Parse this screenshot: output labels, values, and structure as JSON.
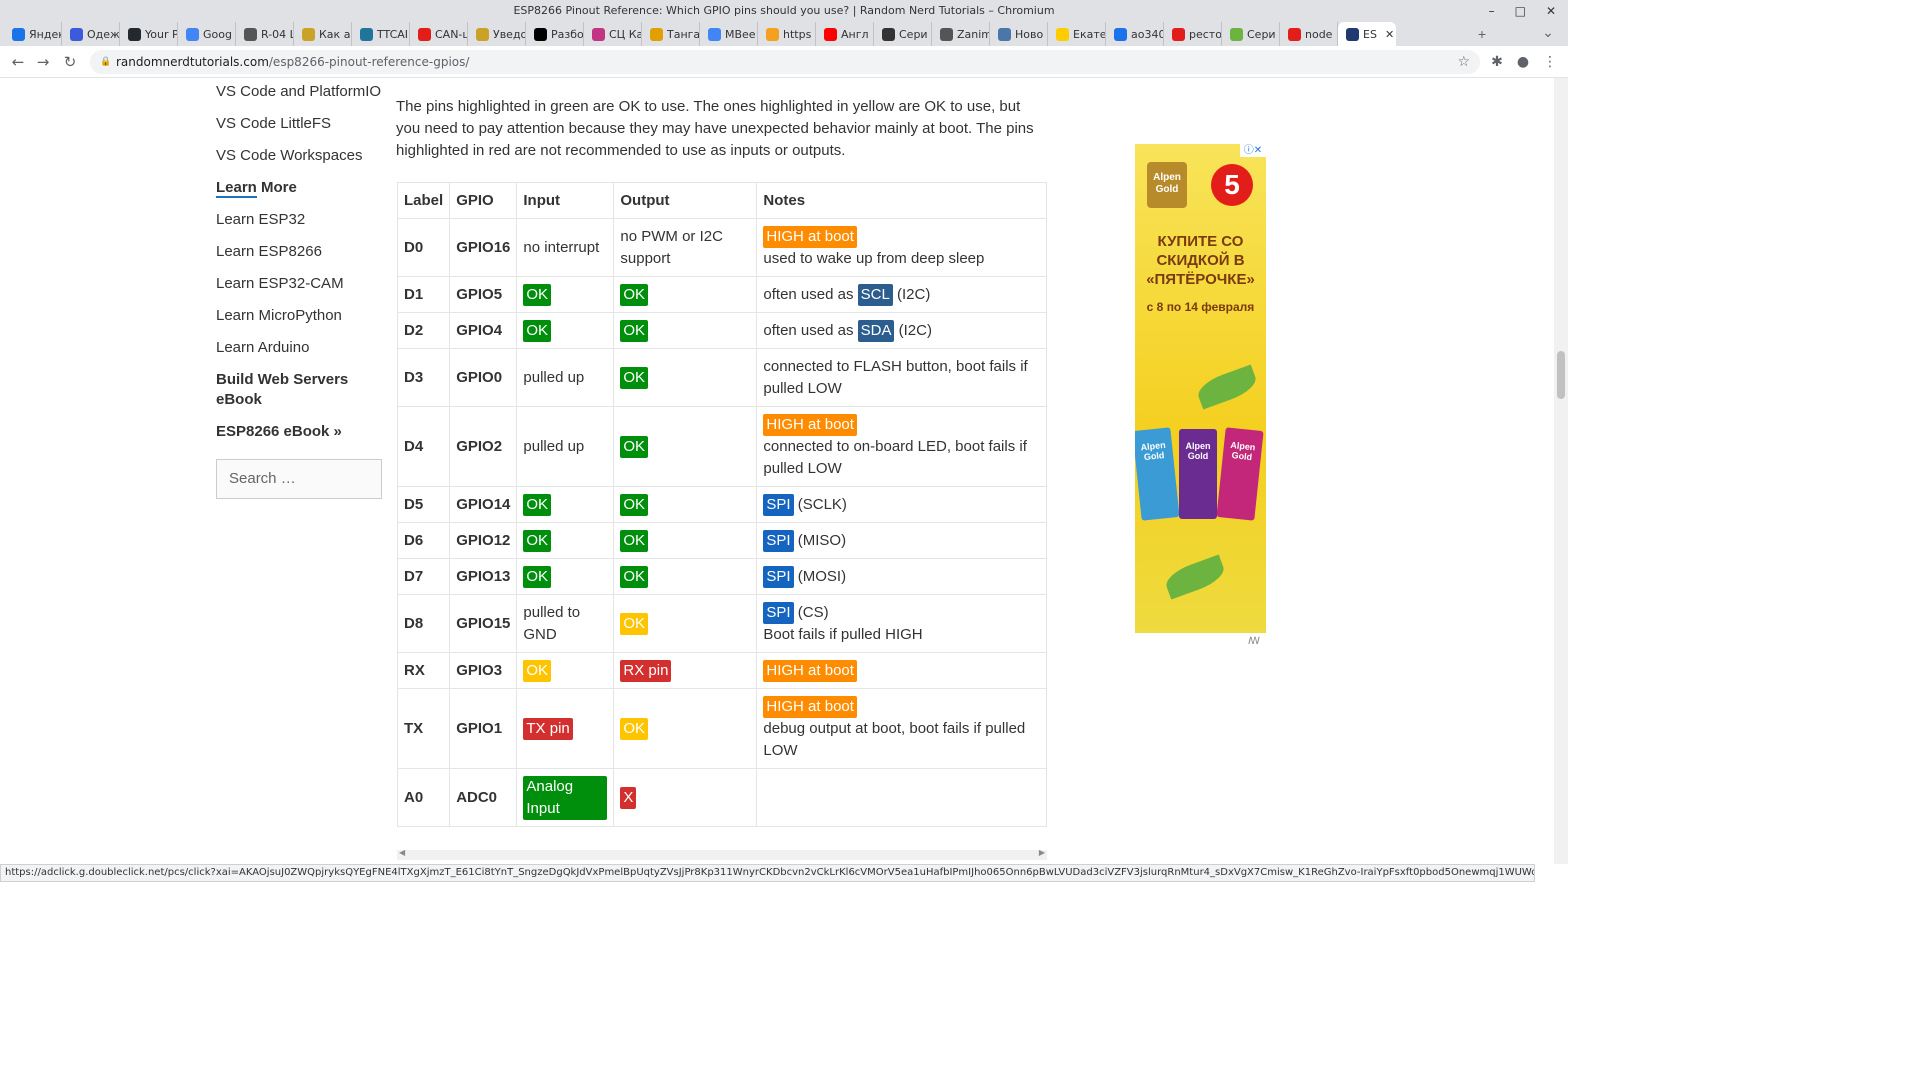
{
  "window": {
    "title": "ESP8266 Pinout Reference: Which GPIO pins should you use? | Random Nerd Tutorials – Chromium"
  },
  "tabs": [
    {
      "label": "Яндекс",
      "color": "#1a73e8"
    },
    {
      "label": "Одеж",
      "color": "#3b5bdb"
    },
    {
      "label": "Your P",
      "color": "#24292e"
    },
    {
      "label": "Goog",
      "color": "#4285f4"
    },
    {
      "label": "R-04 L",
      "color": "#555555"
    },
    {
      "label": "Как а",
      "color": "#c9a227"
    },
    {
      "label": "TTCAI",
      "color": "#21759b"
    },
    {
      "label": "CAN-ц",
      "color": "#e31d1a"
    },
    {
      "label": "Уведо",
      "color": "#c9a227"
    },
    {
      "label": "Разбо",
      "color": "#000000"
    },
    {
      "label": "СЦ Ка",
      "color": "#c13584"
    },
    {
      "label": "Танга",
      "color": "#e0a000"
    },
    {
      "label": "MBee",
      "color": "#4285f4"
    },
    {
      "label": "https",
      "color": "#f4a020"
    },
    {
      "label": "Англ",
      "color": "#ff0000"
    },
    {
      "label": "Сери",
      "color": "#333333"
    },
    {
      "label": "Zanim",
      "color": "#555555"
    },
    {
      "label": "Ново",
      "color": "#4a76a8"
    },
    {
      "label": "Екате",
      "color": "#ffcc00"
    },
    {
      "label": "ao340",
      "color": "#1a73e8"
    },
    {
      "label": "ресто",
      "color": "#e31d1a"
    },
    {
      "label": "Сери",
      "color": "#6cb33f"
    },
    {
      "label": "node",
      "color": "#e31d1a"
    },
    {
      "label": "ES",
      "color": "#1e3a6e",
      "active": true
    }
  ],
  "toolbar": {
    "back_icon": "←",
    "forward_icon": "→",
    "reload_icon": "↻",
    "url_host": "randomnerdtutorials.com",
    "url_path": "/esp8266-pinout-reference-gpios/",
    "lock_icon": "🔒",
    "star_icon": "☆",
    "extensions_icon": "✱",
    "profile_icon": "●",
    "menu_icon": "⋮"
  },
  "sidebar": {
    "links": [
      {
        "label": "VS Code and PlatformIO",
        "bold": false
      },
      {
        "label": "VS Code LittleFS",
        "bold": false
      },
      {
        "label": "VS Code Workspaces",
        "bold": false
      },
      {
        "label_a": "Learn",
        "label_b": " More",
        "bold": true
      },
      {
        "label": "Learn ESP32",
        "bold": false
      },
      {
        "label": "Learn ESP8266",
        "bold": false
      },
      {
        "label": "Learn ESP32-CAM",
        "bold": false
      },
      {
        "label": "Learn MicroPython",
        "bold": false
      },
      {
        "label": "Learn Arduino",
        "bold": false
      },
      {
        "label": "Build Web Servers eBook",
        "bold": true
      },
      {
        "label": "ESP8266 eBook »",
        "bold": true
      }
    ],
    "search_placeholder": "Search …"
  },
  "content": {
    "intro": "The pins highlighted in green are OK to use. The ones highlighted in yellow are OK to use, but you need to pay attention because they may have unexpected behavior mainly at boot. The pins highlighted in red are not recommended to use as inputs or outputs.",
    "table": {
      "headers": [
        "Label",
        "GPIO",
        "Input",
        "Output",
        "Notes"
      ],
      "rows": [
        {
          "label": "D0",
          "gpio": "GPIO16",
          "input": {
            "text": "no interrupt"
          },
          "output": {
            "text": "no PWM or I2C support"
          },
          "notes": [
            {
              "badge": "HIGH at boot",
              "cls": "warn"
            },
            {
              "line": "used to wake up from deep sleep"
            }
          ]
        },
        {
          "label": "D1",
          "gpio": "GPIO5",
          "input": {
            "badge": "OK",
            "cls": "ok"
          },
          "output": {
            "badge": "OK",
            "cls": "ok"
          },
          "notes": [
            {
              "pre": "often used as ",
              "badge": "SCL",
              "cls": "dblue",
              "post": " (I2C)"
            }
          ]
        },
        {
          "label": "D2",
          "gpio": "GPIO4",
          "input": {
            "badge": "OK",
            "cls": "ok"
          },
          "output": {
            "badge": "OK",
            "cls": "ok"
          },
          "notes": [
            {
              "pre": "often used as ",
              "badge": "SDA",
              "cls": "dblue",
              "post": " (I2C)"
            }
          ]
        },
        {
          "label": "D3",
          "gpio": "GPIO0",
          "input": {
            "text": "pulled up"
          },
          "output": {
            "badge": "OK",
            "cls": "ok"
          },
          "notes": [
            {
              "line": "connected to FLASH button, boot fails if pulled LOW"
            }
          ]
        },
        {
          "label": "D4",
          "gpio": "GPIO2",
          "input": {
            "text": "pulled up"
          },
          "output": {
            "badge": "OK",
            "cls": "ok"
          },
          "notes": [
            {
              "badge": "HIGH at boot",
              "cls": "warn"
            },
            {
              "line": "connected to on-board LED, boot fails if pulled LOW"
            }
          ]
        },
        {
          "label": "D5",
          "gpio": "GPIO14",
          "input": {
            "badge": "OK",
            "cls": "ok"
          },
          "output": {
            "badge": "OK",
            "cls": "ok"
          },
          "notes": [
            {
              "badge": "SPI",
              "cls": "blue",
              "post": " (SCLK)"
            }
          ]
        },
        {
          "label": "D6",
          "gpio": "GPIO12",
          "input": {
            "badge": "OK",
            "cls": "ok"
          },
          "output": {
            "badge": "OK",
            "cls": "ok"
          },
          "notes": [
            {
              "badge": "SPI",
              "cls": "blue",
              "post": " (MISO)"
            }
          ]
        },
        {
          "label": "D7",
          "gpio": "GPIO13",
          "input": {
            "badge": "OK",
            "cls": "ok"
          },
          "output": {
            "badge": "OK",
            "cls": "ok"
          },
          "notes": [
            {
              "badge": "SPI",
              "cls": "blue",
              "post": " (MOSI)"
            }
          ]
        },
        {
          "label": "D8",
          "gpio": "GPIO15",
          "input": {
            "text": "pulled to GND"
          },
          "output": {
            "badge": "OK",
            "cls": "okw"
          },
          "notes": [
            {
              "badge": "SPI",
              "cls": "blue",
              "post": " (CS)"
            },
            {
              "line": "Boot fails if pulled HIGH"
            }
          ]
        },
        {
          "label": "RX",
          "gpio": "GPIO3",
          "input": {
            "badge": "OK",
            "cls": "okw"
          },
          "output": {
            "badge": "RX pin",
            "cls": "bad"
          },
          "notes": [
            {
              "badge": "HIGH at boot",
              "cls": "warn"
            }
          ]
        },
        {
          "label": "TX",
          "gpio": "GPIO1",
          "input": {
            "badge": "TX pin",
            "cls": "bad"
          },
          "output": {
            "badge": "OK",
            "cls": "okw"
          },
          "notes": [
            {
              "badge": "HIGH at boot",
              "cls": "warn"
            },
            {
              "line": "debug output at boot, boot fails if pulled LOW"
            }
          ]
        },
        {
          "label": "A0",
          "gpio": "ADC0",
          "input": {
            "badge": "Analog Input",
            "cls": "ok",
            "block": true
          },
          "output": {
            "badge": "X",
            "cls": "bad"
          },
          "notes": []
        }
      ]
    }
  },
  "ad": {
    "brand": "Alpen Gold",
    "store_logo": "5",
    "headline": "КУПИТЕ СО СКИДКОЙ В «ПЯТЁРОЧКЕ»",
    "dates": "с 8 по 14 февраля",
    "close_icon": "ⓘ✕",
    "mark": "ꟿ"
  },
  "statusbar": {
    "url": "https://adclick.g.doubleclick.net/pcs/click?xai=AKAOjsuJ0ZWQpjryksQYEgFNE4lTXgXjmzT_E61Ci8tYnT_SngzeDgQkJdVxPmelBpUqtyZVsJjPr8Kp311WnyrCKDbcvn2vCkLrKl6cVMOrV5ea1uHafbIPmIJho065Onn6pBwLVUDad3ciVZFV3jslurqRnMtur4_sDxVgX7Cmisw_K1ReGhZvo-IraiYpFsxft0pbod5Onewmqj1WUWorb7yU…"
  }
}
